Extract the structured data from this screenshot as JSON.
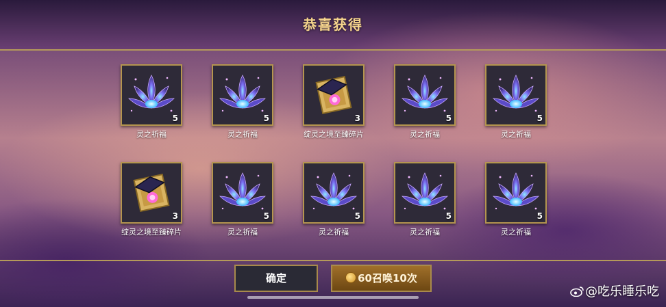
{
  "header": {
    "title": "恭喜获得"
  },
  "rewards": [
    {
      "name": "灵之祈福",
      "qty": "5",
      "icon": "lotus-icon"
    },
    {
      "name": "灵之祈福",
      "qty": "5",
      "icon": "lotus-icon"
    },
    {
      "name": "绽灵之境至臻碎片",
      "qty": "3",
      "icon": "fragment-icon"
    },
    {
      "name": "灵之祈福",
      "qty": "5",
      "icon": "lotus-icon"
    },
    {
      "name": "灵之祈福",
      "qty": "5",
      "icon": "lotus-icon"
    },
    {
      "name": "绽灵之境至臻碎片",
      "qty": "3",
      "icon": "fragment-icon"
    },
    {
      "name": "灵之祈福",
      "qty": "5",
      "icon": "lotus-icon"
    },
    {
      "name": "灵之祈福",
      "qty": "5",
      "icon": "lotus-icon"
    },
    {
      "name": "灵之祈福",
      "qty": "5",
      "icon": "lotus-icon"
    },
    {
      "name": "灵之祈福",
      "qty": "5",
      "icon": "lotus-icon"
    }
  ],
  "buttons": {
    "confirm": "确定",
    "summon": "60召唤10次"
  },
  "watermark": {
    "text": "@吃乐睡乐吃"
  },
  "colors": {
    "title": "#f6d58d",
    "frame": "#b4954f",
    "summon": "#a0702a"
  }
}
